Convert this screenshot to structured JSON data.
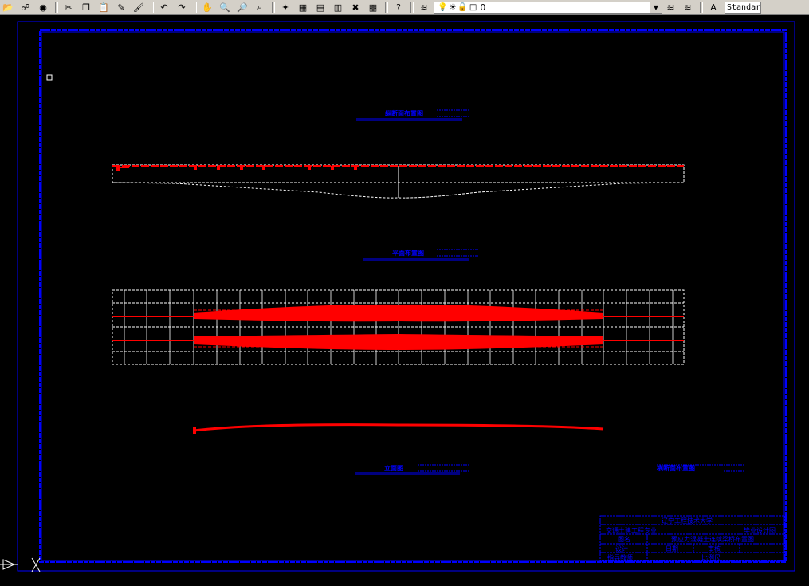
{
  "toolbar": {
    "buttons": [
      {
        "name": "open-icon",
        "glyph": "📂"
      },
      {
        "name": "publish-icon",
        "glyph": "☍"
      },
      {
        "name": "globe-icon",
        "glyph": "◉"
      },
      {
        "name": "cut-icon",
        "glyph": "✂"
      },
      {
        "name": "copy-icon",
        "glyph": "❐"
      },
      {
        "name": "paste-icon",
        "glyph": "📋"
      },
      {
        "name": "pencil-icon",
        "glyph": "✎"
      },
      {
        "name": "match-properties-icon",
        "glyph": "🖌"
      },
      {
        "name": "undo-icon",
        "glyph": "↶"
      },
      {
        "name": "redo-icon",
        "glyph": "↷"
      },
      {
        "name": "pan-icon",
        "glyph": "✋"
      },
      {
        "name": "zoom-realtime-icon",
        "glyph": "🔍"
      },
      {
        "name": "zoom-window-icon",
        "glyph": "🔎"
      },
      {
        "name": "zoom-previous-icon",
        "glyph": "⌕"
      },
      {
        "name": "properties-icon",
        "glyph": "✦"
      },
      {
        "name": "design-center-icon",
        "glyph": "▦"
      },
      {
        "name": "tool-palette-icon",
        "glyph": "▤"
      },
      {
        "name": "sheet-set-icon",
        "glyph": "▥"
      },
      {
        "name": "markup-icon",
        "glyph": "✖"
      },
      {
        "name": "calculator-icon",
        "glyph": "▩"
      },
      {
        "name": "help-icon",
        "glyph": "?"
      }
    ],
    "layer_manager_icon": "layers-icon",
    "layer_value": "0",
    "layer_state_icons": [
      "lightbulb-icon",
      "sun-icon",
      "lock-icon",
      "color-swatch-icon"
    ],
    "text_style_value": "Standar"
  },
  "title_block": {
    "school": "辽宁工程技术大学",
    "major": "交通土建工程专业",
    "design_type": "毕业设计图",
    "label_drawing": "图名",
    "drawing_name": "预应力混凝土连续梁桥布置图",
    "label_designer": "设计",
    "label_date": "日期",
    "label_checker": "审核",
    "label_advisor": "指导教师",
    "advisor_value": "比例尺"
  },
  "sections": {
    "title_1": "纵断面布置图",
    "title_2": "平面布置图",
    "title_3": "立面图",
    "title_4": "横断面布置图"
  },
  "colors": {
    "background": "#000000",
    "frame": "#0000ff",
    "beam": "#ff0000",
    "guide": "#ffffff"
  }
}
